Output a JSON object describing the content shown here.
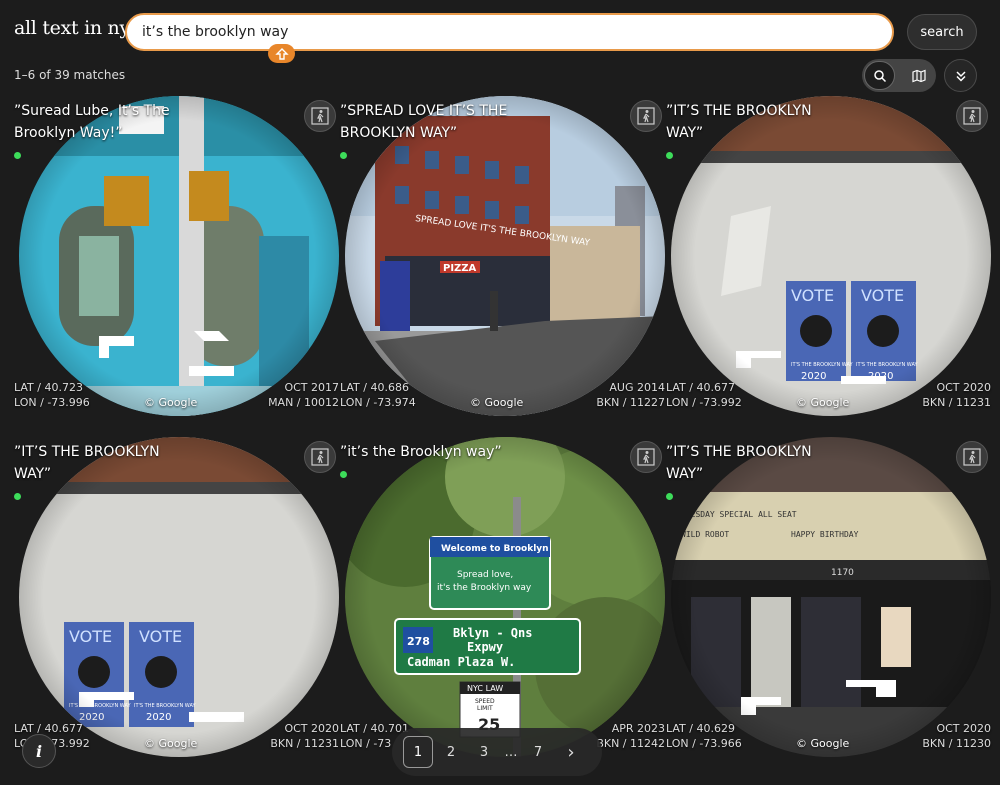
{
  "app_title": "all text in nyc",
  "search": {
    "query": "it’s the brooklyn way",
    "button": "search"
  },
  "result_count": "1–6 of 39 matches",
  "cards": [
    {
      "quote": "”Suread Lube, It’s The Brooklyn Way!”",
      "lat": "LAT / 40.723",
      "lon": "LON / -73.996",
      "date": "OCT 2017",
      "area": "MAN / 10012",
      "credit": "© Google"
    },
    {
      "quote": "”SPREAD LOVE IT’S THE BROOKLYN WAY”",
      "lat": "LAT / 40.686",
      "lon": "LON / -73.974",
      "date": "AUG 2014",
      "area": "BKN / 11227",
      "credit": "© Google"
    },
    {
      "quote": "”IT’S THE BROOKLYN WAY”",
      "lat": "LAT / 40.677",
      "lon": "LON / -73.992",
      "date": "OCT 2020",
      "area": "BKN / 11231",
      "credit": "© Google"
    },
    {
      "quote": "”IT’S THE BROOKLYN WAY”",
      "lat": "LAT / 40.677",
      "lon": "LON / -73.992",
      "date": "OCT 2020",
      "area": "BKN / 11231",
      "credit": "© Google"
    },
    {
      "quote": "”it’s the Brooklyn way”",
      "lat": "LAT / 40.701",
      "lon": "LON / -73",
      "date": "APR 2023",
      "area": "BKN / 11242",
      "credit": ""
    },
    {
      "quote": "”IT’S THE BROOKLYN WAY”",
      "lat": "LAT / 40.629",
      "lon": "LON / -73.966",
      "date": "OCT 2020",
      "area": "BKN / 11230",
      "credit": "© Google"
    }
  ],
  "scene_text": {
    "c2_banner": "SPREAD LOVE IT'S THE BROOKLYN WAY",
    "c2_pizza": "PIZZA",
    "c3_vote": "VOTE",
    "c3_poster": "IT'S THE BROOKLYN WAY",
    "c3_year": "2020",
    "c5_welcome": "Welcome to Brooklyn",
    "c5_spread": "Spread love,",
    "c5_way": "it's the Brooklyn way",
    "c5_route": "278",
    "c5_line1": "Bklyn - Qns",
    "c5_line2": "Expwy",
    "c5_line3": "Cadman Plaza W.",
    "c5_nyclaw": "NYC LAW",
    "c5_speed": "SPEED",
    "c5_limit": "LIMIT",
    "c5_25": "25",
    "c6_marquee1": "TUESDAY SPECIAL ALL SEAT",
    "c6_marquee2": "WILD ROBOT",
    "c6_marquee3": "HAPPY BIRTHDAY",
    "c6_num": "1170"
  },
  "pagination": {
    "pages": [
      "1",
      "2",
      "3",
      "…",
      "7"
    ],
    "next": "›",
    "current": "1"
  },
  "info_label": "i"
}
